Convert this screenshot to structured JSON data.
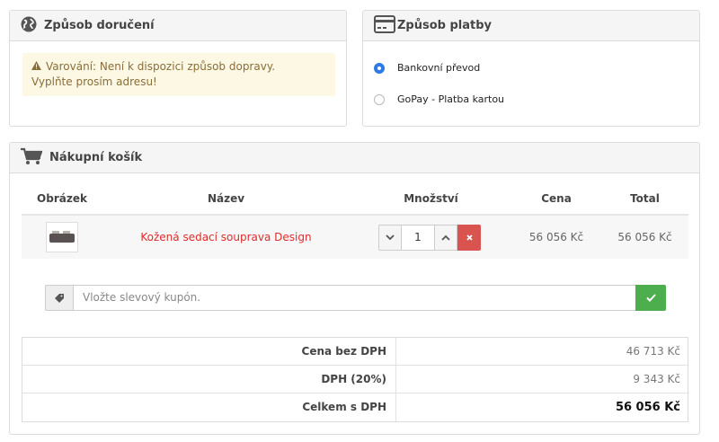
{
  "delivery": {
    "title": "Způsob doručení",
    "icon": "globe-icon",
    "warning_line1": "Varování: Není k dispozici způsob dopravy.",
    "warning_line2": "Vyplňte prosím adresu!"
  },
  "payment": {
    "title": "Způsob platby",
    "icon": "credit-card-icon",
    "options": [
      {
        "label": "Bankovní převod",
        "selected": true
      },
      {
        "label": "GoPay - Platba kartou",
        "selected": false
      }
    ]
  },
  "cart": {
    "title": "Nákupní košík",
    "icon": "shopping-cart-icon",
    "columns": {
      "image": "Obrázek",
      "name": "Název",
      "quantity": "Množství",
      "price": "Cena",
      "total": "Total"
    },
    "items": [
      {
        "name": "Kožená sedací souprava Design",
        "quantity": "1",
        "price": "56 056 Kč",
        "total": "56 056 Kč"
      }
    ],
    "coupon_placeholder": "Vložte slevový kupón.",
    "totals": [
      {
        "label": "Cena bez DPH",
        "value": "46 713 Kč"
      },
      {
        "label": "DPH (20%)",
        "value": "9 343 Kč"
      },
      {
        "label": "Celkem s DPH",
        "value": "56 056 Kč"
      }
    ]
  },
  "colors": {
    "accent_blue": "#2d7be5",
    "danger": "#d9534f",
    "success": "#4cae4c",
    "warning_bg": "#fcf8e3",
    "product_link": "#e02b2b"
  }
}
